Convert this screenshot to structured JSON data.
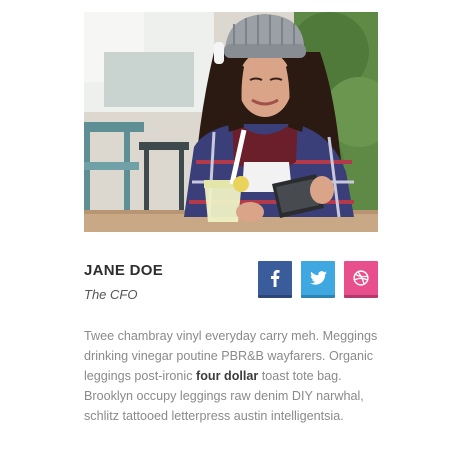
{
  "profile": {
    "name": "JANE DOE",
    "role": "The CFO"
  },
  "social": {
    "facebook_icon": "facebook-icon",
    "twitter_icon": "twitter-icon",
    "dribbble_icon": "dribbble-icon",
    "facebook_color": "#3b5c9b",
    "twitter_color": "#3fa8e0",
    "dribbble_color": "#e8508d"
  },
  "bio": {
    "before": "Twee chambray vinyl everyday carry meh. Meggings drinking vinegar poutine PBR&B wayfarers. Organic leggings post-ironic ",
    "bold": "four dollar",
    "after": " toast tote bag. Brooklyn occupy leggings raw denim DIY narwhal, schlitz tattooed letterpress austin intelligentsia."
  }
}
